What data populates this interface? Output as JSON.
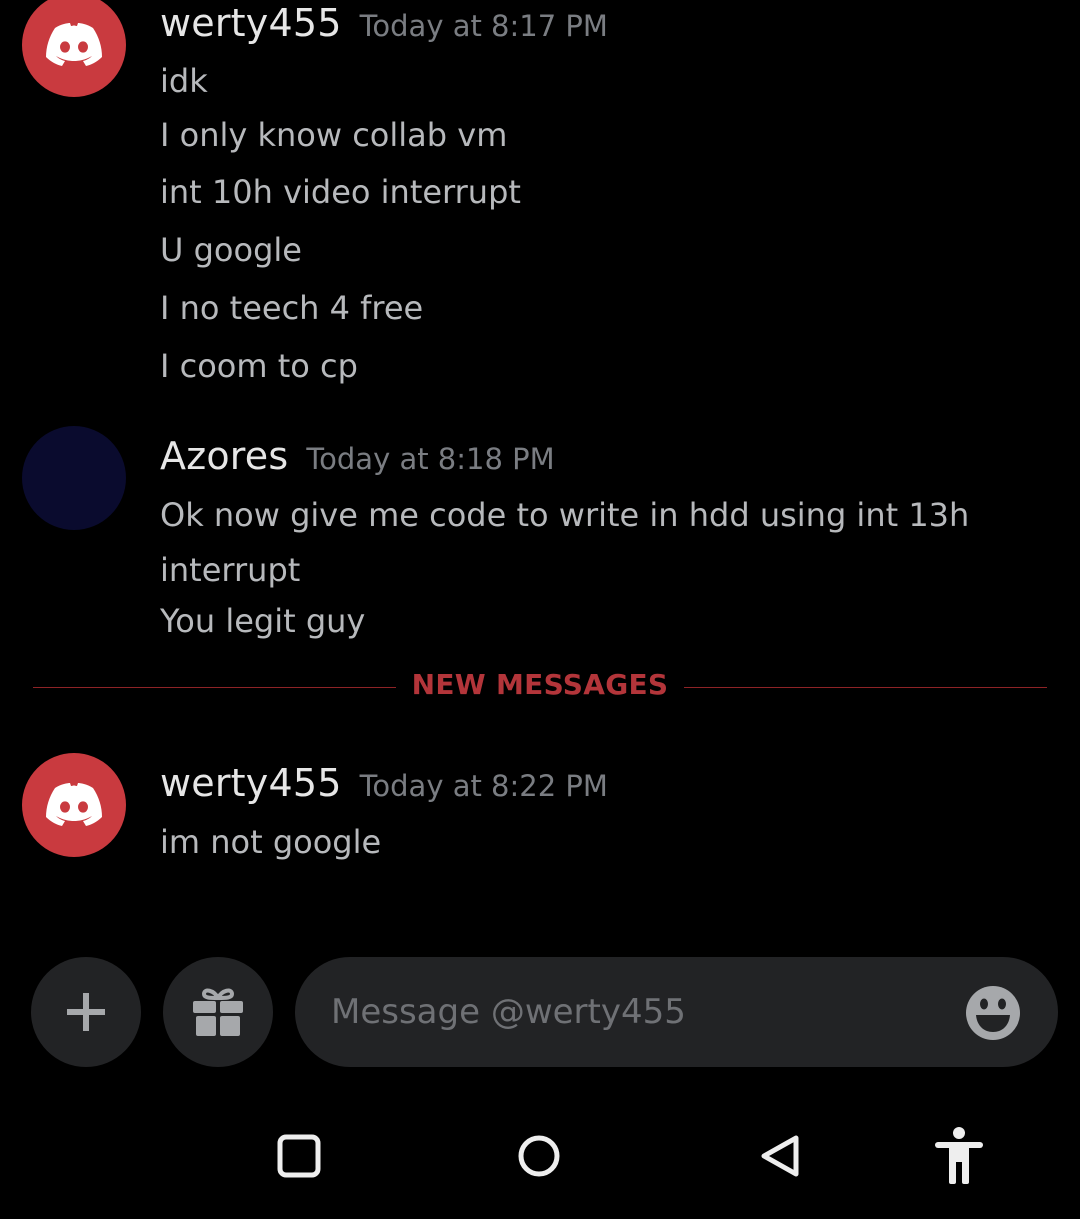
{
  "messages": [
    {
      "username": "werty455",
      "timestamp": "Today at 8:17 PM",
      "lines": [
        "idk",
        "I only know collab vm",
        "int 10h video interrupt",
        "U google",
        "I no teech 4 free",
        "I coom to cp"
      ]
    },
    {
      "username": "Azores",
      "timestamp": "Today at 8:18 PM",
      "lines": [
        "Ok now give me code to write in hdd using int 13h",
        "interrupt",
        "You legit guy"
      ]
    }
  ],
  "divider": {
    "label": "NEW MESSAGES"
  },
  "new_messages": [
    {
      "username": "werty455",
      "timestamp": "Today at 8:22 PM",
      "lines": [
        "im not google"
      ]
    }
  ],
  "composer": {
    "placeholder": "Message @werty455",
    "value": "",
    "icons": [
      "plus-icon",
      "gift-icon",
      "emoji-icon"
    ]
  },
  "system_nav": {
    "icons": [
      "recents-icon",
      "home-icon",
      "back-icon",
      "accessibility-icon"
    ]
  },
  "colors": {
    "background": "#000000",
    "avatar_red": "#c93a3f",
    "avatar_navy": "#0a0b2e",
    "divider": "#b3353a",
    "input_bg": "#222325"
  }
}
